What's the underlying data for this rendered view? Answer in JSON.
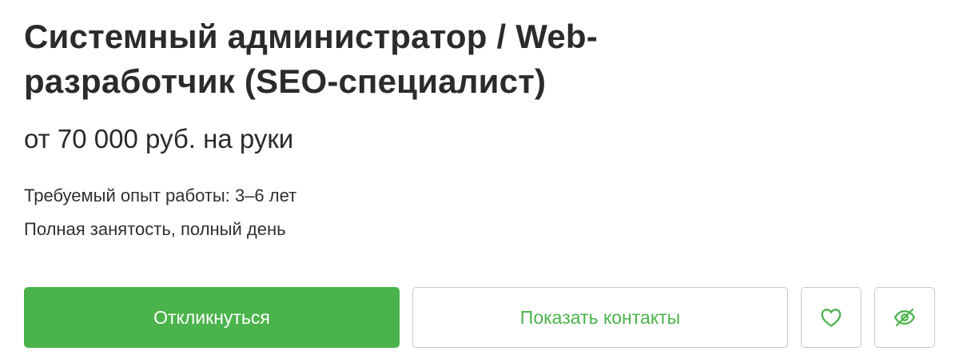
{
  "vacancy": {
    "title": "Системный администратор / Web-разработчик (SEO-специалист)",
    "salary": "от 70 000 руб. на руки",
    "experience": "Требуемый опыт работы: 3–6 лет",
    "employment": "Полная занятость, полный день"
  },
  "actions": {
    "respond_label": "Откликнуться",
    "contacts_label": "Показать контакты",
    "favorite_icon": "heart-icon",
    "hide_icon": "eye-off-icon"
  },
  "colors": {
    "accent": "#4bb34b",
    "text": "#2b2b2b",
    "border": "#c9c9c9"
  }
}
